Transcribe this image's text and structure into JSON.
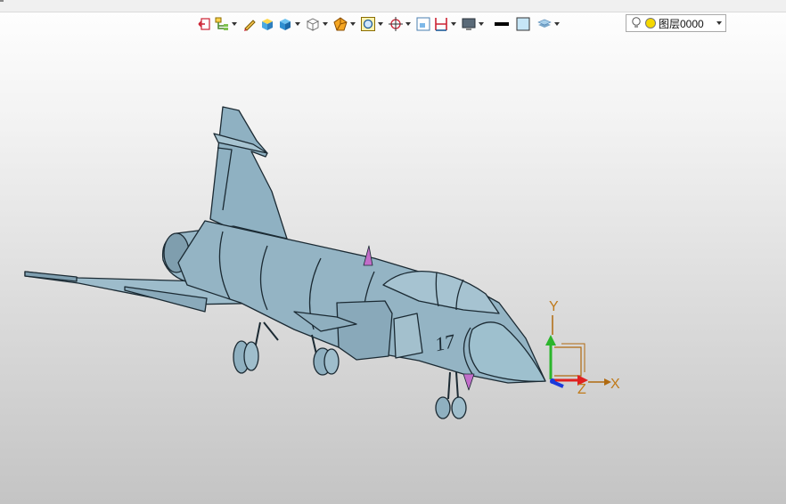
{
  "toolbar": {
    "items": [
      {
        "icon": "exit-sketch-icon",
        "caret": false
      },
      {
        "icon": "layer-tree-icon",
        "caret": true
      },
      {
        "icon": "pencil-icon",
        "caret": false
      },
      {
        "icon": "box-solid-icon",
        "caret": false
      },
      {
        "icon": "shaded-cube-icon",
        "caret": true
      },
      {
        "icon": "wireframe-cube-icon",
        "caret": true
      },
      {
        "icon": "render-style-icon",
        "caret": true
      },
      {
        "icon": "zoom-fit-icon",
        "caret": true
      },
      {
        "icon": "snap-point-icon",
        "caret": true
      },
      {
        "icon": "view-frame-icon",
        "caret": false
      },
      {
        "icon": "dimension-icon",
        "caret": true
      },
      {
        "icon": "monitor-icon",
        "caret": true
      },
      {
        "icon": "line-color-icon",
        "caret": false
      },
      {
        "icon": "fill-color-icon",
        "caret": false
      },
      {
        "icon": "layer-stack-icon",
        "caret": true
      }
    ],
    "layer_select": {
      "value": "图层0000"
    }
  },
  "triad": {
    "x_label": "X",
    "y_label": "Y",
    "z_label": "Z"
  },
  "model": {
    "tail_number": "17"
  },
  "colors": {
    "fuselage": "#94b4c4",
    "outline": "#1b2a33",
    "antenna": "#c26dc9",
    "axis_label": "#c07a1a"
  }
}
